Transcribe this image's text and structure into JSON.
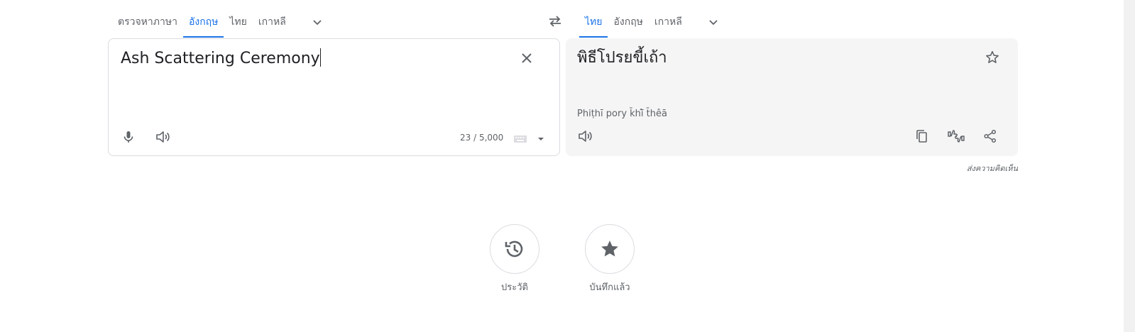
{
  "source_langs": {
    "tabs": [
      {
        "label": "ตรวจหาภาษา",
        "active": false
      },
      {
        "label": "อังกฤษ",
        "active": true
      },
      {
        "label": "ไทย",
        "active": false
      },
      {
        "label": "เกาหลี",
        "active": false
      }
    ],
    "more_icon": "chevron-down-icon"
  },
  "swap_icon": "swap-arrows-icon",
  "target_langs": {
    "tabs": [
      {
        "label": "ไทย",
        "active": true
      },
      {
        "label": "อังกฤษ",
        "active": false
      },
      {
        "label": "เกาหลี",
        "active": false
      }
    ],
    "more_icon": "chevron-down-icon"
  },
  "source": {
    "text": "Ash Scattering Ceremony",
    "char_count": "23 / 5,000",
    "icons": [
      "microphone-icon",
      "speaker-icon",
      "close-icon",
      "keyboard-icon",
      "dropdown-arrow-icon"
    ]
  },
  "target": {
    "text": "พิธีโปรยขี้เถ้า",
    "romanization": "Phiṭhī pory k̄hī̂ t̄hêā",
    "icons": [
      "star-outline-icon",
      "speaker-icon",
      "copy-icon",
      "feedback-thumbs-icon",
      "share-icon"
    ]
  },
  "feedback_label": "ส่งความคิดเห็น",
  "bottom_actions": [
    {
      "label": "ประวัติ",
      "icon": "history-icon"
    },
    {
      "label": "บันทึกแล้ว",
      "icon": "star-icon"
    }
  ],
  "colors": {
    "accent": "#1a73e8",
    "icon": "#5f6368",
    "panel_bg": "#f5f5f5"
  }
}
